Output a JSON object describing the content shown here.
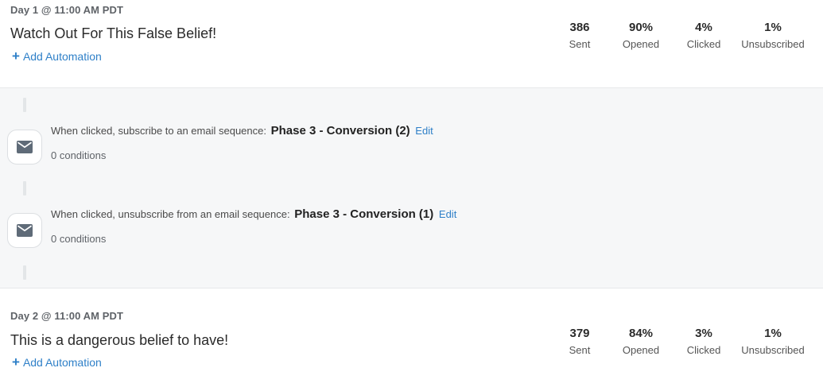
{
  "emails": [
    {
      "day": "Day 1 @ 11:00 AM PDT",
      "subject": "Watch Out For This False Belief!",
      "add_automation": "Add Automation",
      "stats": {
        "sent": "386",
        "sent_label": "Sent",
        "opened": "90%",
        "opened_label": "Opened",
        "clicked": "4%",
        "clicked_label": "Clicked",
        "unsubscribed": "1%",
        "unsubscribed_label": "Unsubscribed"
      }
    },
    {
      "day": "Day 2 @ 11:00 AM PDT",
      "subject": "This is a dangerous belief to have!",
      "add_automation": "Add Automation",
      "stats": {
        "sent": "379",
        "sent_label": "Sent",
        "opened": "84%",
        "opened_label": "Opened",
        "clicked": "3%",
        "clicked_label": "Clicked",
        "unsubscribed": "1%",
        "unsubscribed_label": "Unsubscribed"
      }
    }
  ],
  "automations": [
    {
      "icon": "mail-icon",
      "description": "When clicked, subscribe to an email sequence:",
      "sequence": "Phase 3 - Conversion (2)",
      "edit_label": "Edit",
      "conditions": "0 conditions"
    },
    {
      "icon": "mail-icon",
      "description": "When clicked, unsubscribe from an email sequence:",
      "sequence": "Phase 3 - Conversion (1)",
      "edit_label": "Edit",
      "conditions": "0 conditions"
    }
  ],
  "colors": {
    "link": "#2f80c8",
    "background": "#f6f7f8",
    "card": "#ffffff",
    "icon": "#5f6b78"
  }
}
